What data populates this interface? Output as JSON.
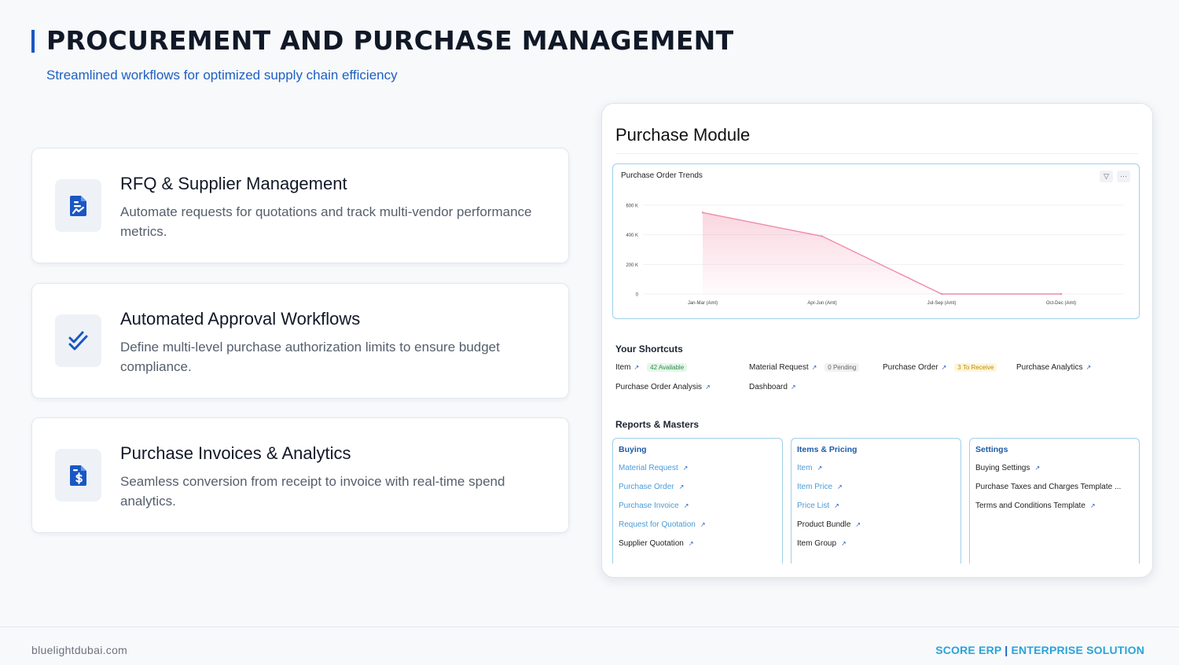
{
  "header": {
    "title": "PROCUREMENT AND PURCHASE MANAGEMENT",
    "subtitle": "Streamlined workflows for optimized supply chain efficiency"
  },
  "features": [
    {
      "icon": "document-chart-icon",
      "title": "RFQ & Supplier Management",
      "description": "Automate requests for quotations and track multi-vendor performance metrics."
    },
    {
      "icon": "double-check-icon",
      "title": "Automated Approval Workflows",
      "description": "Define multi-level purchase authorization limits to ensure budget compliance."
    },
    {
      "icon": "invoice-dollar-icon",
      "title": "Purchase Invoices & Analytics",
      "description": "Seamless conversion from receipt to invoice with real-time spend analytics."
    }
  ],
  "module": {
    "title": "Purchase Module",
    "chart_title": "Purchase Order Trends",
    "shortcuts_title": "Your Shortcuts",
    "shortcuts": [
      {
        "label": "Item",
        "badge": "42 Available",
        "badge_style": "green"
      },
      {
        "label": "Material Request",
        "badge": "0 Pending",
        "badge_style": "gray"
      },
      {
        "label": "Purchase Order",
        "badge": "3 To Receive",
        "badge_style": "yellow"
      },
      {
        "label": "Purchase Analytics",
        "badge": "",
        "badge_style": ""
      },
      {
        "label": "Purchase Order Analysis",
        "badge": "",
        "badge_style": ""
      },
      {
        "label": "Dashboard",
        "badge": "",
        "badge_style": ""
      }
    ],
    "reports_title": "Reports & Masters",
    "masters": [
      {
        "title": "Buying",
        "links": [
          "Material Request",
          "Purchase Order",
          "Purchase Invoice",
          "Request for Quotation",
          "Supplier Quotation"
        ]
      },
      {
        "title": "Items & Pricing",
        "links": [
          "Item",
          "Item Price",
          "Price List",
          "Product Bundle",
          "Item Group"
        ]
      },
      {
        "title": "Settings",
        "links": [
          "Buying Settings",
          "Purchase Taxes and Charges Template ...",
          "Terms and Conditions Template"
        ]
      }
    ]
  },
  "chart_data": {
    "type": "area",
    "title": "Purchase Order Trends",
    "categories": [
      "Jan-Mar (Amt)",
      "Apr-Jun (Amt)",
      "Jul-Sep (Amt)",
      "Oct-Dec (Amt)"
    ],
    "values": [
      550000,
      390000,
      0,
      0
    ],
    "yticks": [
      "0",
      "200 K",
      "400 K",
      "600 K"
    ],
    "ylim": [
      0,
      600000
    ],
    "grid": true,
    "color": "#f08aa8"
  },
  "footer": {
    "website": "bluelightdubai.com",
    "brand": "SCORE ERP",
    "separator": "|",
    "tagline": "ENTERPRISE SOLUTION"
  },
  "colors": {
    "accent": "#1a56c4",
    "brand_cyan": "#2aa3d8",
    "chart_line": "#f08aa8"
  }
}
